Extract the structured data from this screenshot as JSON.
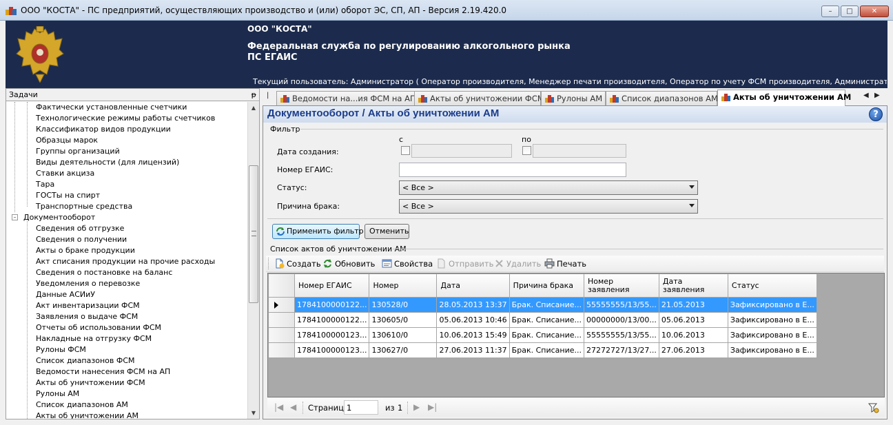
{
  "window": {
    "title": "ООО \"КОСТА\" - ПС предприятий, осуществляющих производство и (или) оборот ЭС, СП, АП - Версия 2.19.420.0",
    "minimize_label": "–",
    "maximize_label": "□",
    "close_label": "✕"
  },
  "banner": {
    "org": "ООО \"КОСТА\"",
    "service": "Федеральная служба по регулированию алкогольного рынка",
    "system": "ПС ЕГАИС",
    "user": "Текущий пользователь: Администратор ( Оператор производителя, Менеджер печати производителя, Оператор по учету ФСМ производителя, Администратор производителя, О..."
  },
  "tasks": {
    "header": "Задачи",
    "pin": "ᵽ",
    "items_top": [
      "Фактически установленные счетчики",
      "Технологические режимы работы счетчиков",
      "Классификатор видов продукции",
      "Образцы марок",
      "Группы организаций",
      "Виды деятельности (для лицензий)",
      "Ставки акциза",
      "Тара",
      "ГОСТы на спирт",
      "Транспортные средства"
    ],
    "group": "Документооборот",
    "group_expander": "–",
    "items_group": [
      "Сведения об отгрузке",
      "Сведения о получении",
      "Акты о браке продукции",
      "Акт списания продукции на прочие расходы",
      "Сведения о постановке на баланс",
      "Уведомления о перевозке",
      "Данные АСИиУ",
      "Акт инвентаризации ФСМ",
      "Заявления о выдаче ФСМ",
      "Отчеты об использовании ФСМ",
      "Накладные на отгрузку ФСМ",
      "Рулоны ФСМ",
      "Список диапазонов ФСМ",
      "Ведомости нанесения ФСМ на АП",
      "Акты об уничтожении ФСМ",
      "Рулоны АМ",
      "Список диапазонов АМ",
      "Акты об уничтожении АМ"
    ]
  },
  "tabs": {
    "items": [
      {
        "label": "Ведомости на...ия ФСМ на АП"
      },
      {
        "label": "Акты об уничтожении ФСМ"
      },
      {
        "label": "Рулоны АМ"
      },
      {
        "label": "Список диапазонов АМ"
      },
      {
        "label": "Акты об уничтожении АМ"
      }
    ],
    "prev": "◀",
    "next": "▶"
  },
  "content": {
    "title": "Документооборот / Акты об уничтожении АМ",
    "help": "?",
    "filter": {
      "group_label": "Фильтр",
      "from_label": "с",
      "to_label": "по",
      "created_label": "Дата создания:",
      "egais_label": "Номер ЕГАИС:",
      "egais_value": "",
      "status_label": "Статус:",
      "status_value": "< Все >",
      "reason_label": "Причина брака:",
      "reason_value": "< Все >",
      "apply_label": "Применить фильтр",
      "cancel_label": "Отменить"
    },
    "list_label": "Список актов об уничтожении АМ",
    "toolbar": {
      "create": "Создать",
      "refresh": "Обновить",
      "properties": "Свойства",
      "send": "Отправить",
      "delete": "Удалить",
      "print": "Печать"
    },
    "grid": {
      "columns": [
        "Номер ЕГАИС",
        "Номер",
        "Дата",
        "Причина брака",
        "Номер заявления",
        "Дата заявления",
        "Статус"
      ],
      "rows": [
        [
          "1784100000122...",
          "130528/0",
          "28.05.2013 13:37",
          "Брак. Списание...",
          "55555555/13/55...",
          "21.05.2013",
          "Зафиксировано в Е..."
        ],
        [
          "1784100000122...",
          "130605/0",
          "05.06.2013 10:46",
          "Брак. Списание...",
          "00000000/13/00...",
          "05.06.2013",
          "Зафиксировано в Е..."
        ],
        [
          "1784100000123...",
          "130610/0",
          "10.06.2013 15:49",
          "Брак. Списание...",
          "55555555/13/55...",
          "10.06.2013",
          "Зафиксировано в Е..."
        ],
        [
          "1784100000123...",
          "130627/0",
          "27.06.2013 11:37",
          "Брак. Списание...",
          "27272727/13/27...",
          "27.06.2013",
          "Зафиксировано в Е..."
        ]
      ]
    },
    "pager": {
      "page_label": "Страница",
      "page_value": "1",
      "of_label": "из",
      "total": "1"
    }
  }
}
